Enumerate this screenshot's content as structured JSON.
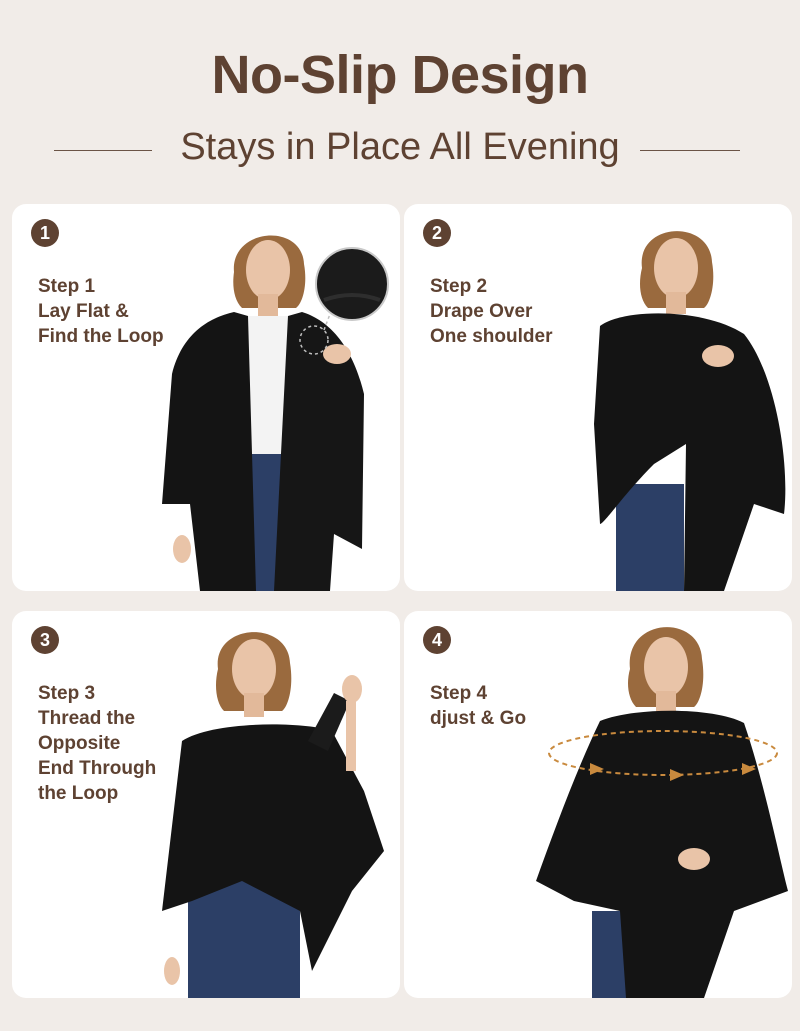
{
  "header": {
    "title": "No-Slip Design",
    "subtitle": "Stays in Place All Evening"
  },
  "steps": [
    {
      "number": "1",
      "lines": [
        "Step 1",
        "Lay Flat &",
        "Find the Loop"
      ]
    },
    {
      "number": "2",
      "lines": [
        "Step 2",
        "Drape Over",
        "One shoulder"
      ]
    },
    {
      "number": "3",
      "lines": [
        "Step 3",
        "Thread the",
        "Opposite",
        "End Through",
        "the Loop"
      ]
    },
    {
      "number": "4",
      "lines": [
        "Step 4",
        "djust & Go"
      ]
    }
  ],
  "colors": {
    "background": "#f1ece8",
    "brand_brown": "#5e4232",
    "garment_black": "#141414",
    "arrow_orange": "#c98a3e"
  }
}
